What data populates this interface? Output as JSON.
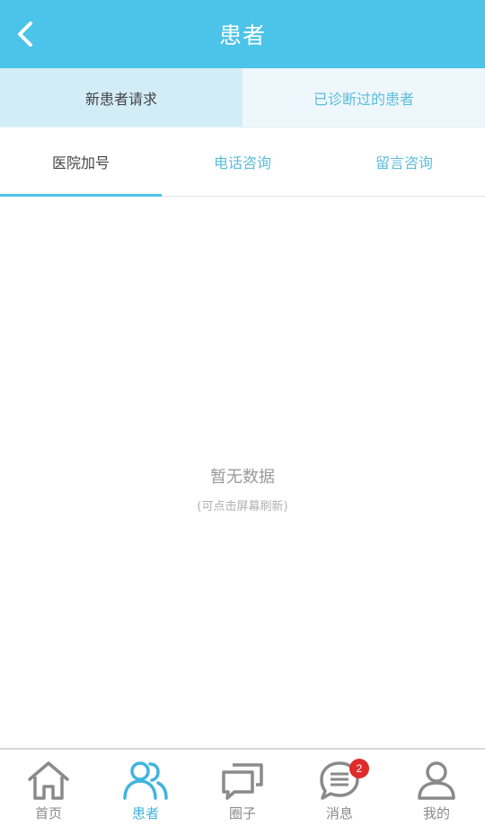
{
  "header": {
    "title": "患者"
  },
  "segments": [
    {
      "label": "新患者请求",
      "active": true
    },
    {
      "label": "已诊断过的患者",
      "active": false
    }
  ],
  "subtabs": [
    {
      "label": "医院加号",
      "active": true
    },
    {
      "label": "电话咨询",
      "active": false
    },
    {
      "label": "留言咨询",
      "active": false
    }
  ],
  "empty": {
    "title": "暂无数据",
    "subtitle": "(可点击屏幕刷新)"
  },
  "tabbar": {
    "items": [
      {
        "label": "首页",
        "icon": "home-icon"
      },
      {
        "label": "患者",
        "icon": "patients-icon",
        "active": true
      },
      {
        "label": "圈子",
        "icon": "chat-bubbles-icon"
      },
      {
        "label": "消息",
        "icon": "message-icon",
        "badge": "2"
      },
      {
        "label": "我的",
        "icon": "person-icon"
      }
    ]
  },
  "colors": {
    "primary": "#4cc3e8",
    "active_text": "#3fb4dd",
    "badge": "#e02b2b"
  }
}
